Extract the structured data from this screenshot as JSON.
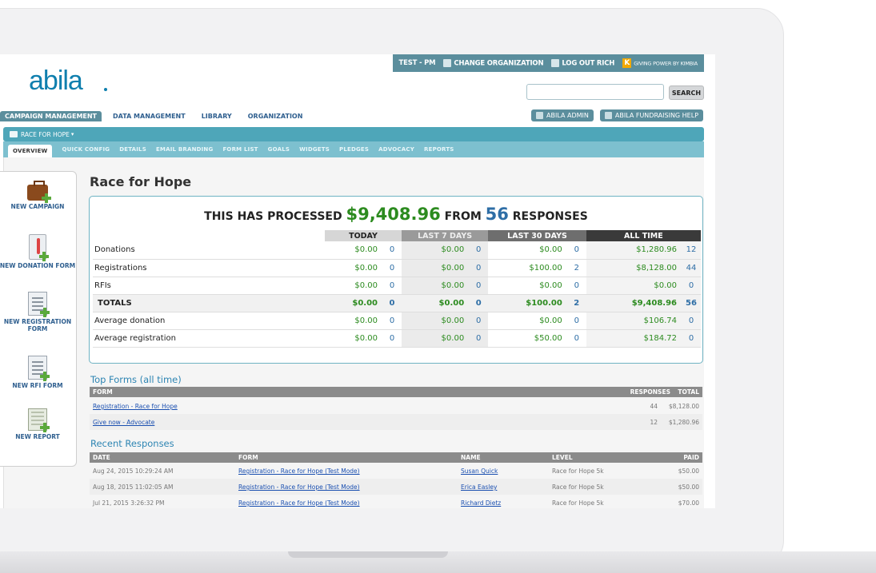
{
  "topbar": {
    "user": "TEST - PM",
    "change_org": "CHANGE ORGANIZATION",
    "logout": "LOG OUT RICH",
    "powered_by": "GIVING POWER BY KIMBIA",
    "k_logo": "K"
  },
  "logo": "abila",
  "search": {
    "placeholder": "",
    "button": "SEARCH"
  },
  "main_nav": [
    {
      "label": "CAMPAIGN MANAGEMENT",
      "active": true
    },
    {
      "label": "DATA MANAGEMENT"
    },
    {
      "label": "LIBRARY"
    },
    {
      "label": "ORGANIZATION"
    }
  ],
  "admin": {
    "abila_admin": "ABILA ADMIN",
    "fundraising_help": "ABILA FUNDRAISING HELP"
  },
  "campaign": {
    "name": "RACE FOR HOPE",
    "caret": "▾"
  },
  "sub_nav": [
    "OVERVIEW",
    "QUICK CONFIG",
    "DETAILS",
    "EMAIL BRANDING",
    "FORM LIST",
    "GOALS",
    "WIDGETS",
    "PLEDGES",
    "ADVOCACY",
    "REPORTS"
  ],
  "sidebar": [
    {
      "label": "NEW CAMPAIGN"
    },
    {
      "label": "NEW DONATION FORM"
    },
    {
      "label": "NEW REGISTRATION FORM"
    },
    {
      "label": "NEW RFI FORM"
    },
    {
      "label": "NEW REPORT"
    }
  ],
  "page_title": "Race for Hope",
  "summary": {
    "prefix": "THIS HAS PROCESSED",
    "amount": "$9,408.96",
    "middle": "FROM",
    "count": "56",
    "suffix": "RESPONSES",
    "headers": [
      "TODAY",
      "LAST 7 DAYS",
      "LAST 30 DAYS",
      "ALL TIME"
    ],
    "rows": [
      {
        "label": "Donations",
        "today": "$0.00",
        "today_n": "0",
        "d7": "$0.00",
        "d7_n": "0",
        "d30": "$0.00",
        "d30_n": "0",
        "all": "$1,280.96",
        "all_n": "12"
      },
      {
        "label": "Registrations",
        "today": "$0.00",
        "today_n": "0",
        "d7": "$0.00",
        "d7_n": "0",
        "d30": "$100.00",
        "d30_n": "2",
        "all": "$8,128.00",
        "all_n": "44"
      },
      {
        "label": "RFIs",
        "today": "$0.00",
        "today_n": "0",
        "d7": "$0.00",
        "d7_n": "0",
        "d30": "$0.00",
        "d30_n": "0",
        "all": "$0.00",
        "all_n": "0"
      },
      {
        "label": "TOTALS",
        "today": "$0.00",
        "today_n": "0",
        "d7": "$0.00",
        "d7_n": "0",
        "d30": "$100.00",
        "d30_n": "2",
        "all": "$9,408.96",
        "all_n": "56"
      },
      {
        "label": "Average donation",
        "today": "$0.00",
        "today_n": "0",
        "d7": "$0.00",
        "d7_n": "0",
        "d30": "$0.00",
        "d30_n": "0",
        "all": "$106.74",
        "all_n": "0"
      },
      {
        "label": "Average registration",
        "today": "$0.00",
        "today_n": "0",
        "d7": "$0.00",
        "d7_n": "0",
        "d30": "$50.00",
        "d30_n": "0",
        "all": "$184.72",
        "all_n": "0"
      }
    ]
  },
  "top_forms": {
    "title": "Top Forms (all time)",
    "headers": {
      "form": "FORM",
      "responses": "RESPONSES",
      "total": "TOTAL"
    },
    "rows": [
      {
        "form": "Registration - Race for Hope",
        "responses": "44",
        "total": "$8,128.00"
      },
      {
        "form": "Give now - Advocate",
        "responses": "12",
        "total": "$1,280.96"
      }
    ]
  },
  "recent": {
    "title": "Recent Responses",
    "headers": {
      "date": "DATE",
      "form": "FORM",
      "name": "NAME",
      "level": "LEVEL",
      "paid": "PAID"
    },
    "rows": [
      {
        "date": "Aug 24, 2015 10:29:24 AM",
        "form": "Registration - Race for Hope (Test Mode)",
        "name": "Susan Quick",
        "level": "Race for Hope 5k",
        "paid": "$50.00"
      },
      {
        "date": "Aug 18, 2015 11:02:05 AM",
        "form": "Registration - Race for Hope (Test Mode)",
        "name": "Erica Easley",
        "level": "Race for Hope 5k",
        "paid": "$50.00"
      },
      {
        "date": "Jul 21, 2015 3:26:32 PM",
        "form": "Registration - Race for Hope (Test Mode)",
        "name": "Richard Dietz",
        "level": "Race for Hope 5k",
        "paid": "$70.00"
      }
    ]
  },
  "colors": {
    "teal": "#5b8e9d",
    "accent_green": "#2c8b1f",
    "accent_blue": "#2e6ea6",
    "logo_blue": "#0f7fae"
  }
}
